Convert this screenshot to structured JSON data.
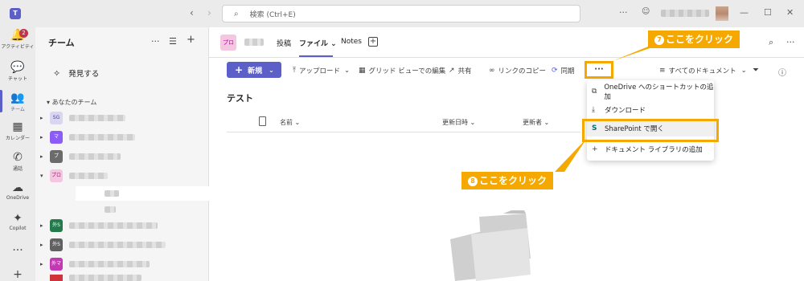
{
  "titlebar": {
    "search_placeholder": "検索 (Ctrl+E)",
    "back": "‹",
    "forward": "›",
    "more": "···",
    "minimize": "—",
    "maximize": "☐",
    "close": "✕"
  },
  "rail": {
    "items": [
      {
        "label": "アクティビティ",
        "icon": "bell-icon",
        "glyph": "🔔",
        "badge": "2"
      },
      {
        "label": "チャット",
        "icon": "chat-icon",
        "glyph": "💬"
      },
      {
        "label": "チーム",
        "icon": "teams-icon",
        "glyph": "👥"
      },
      {
        "label": "カレンダー",
        "icon": "calendar-icon",
        "glyph": "▦"
      },
      {
        "label": "通話",
        "icon": "phone-icon",
        "glyph": "✆"
      },
      {
        "label": "OneDrive",
        "icon": "cloud-icon",
        "glyph": "☁"
      },
      {
        "label": "Copilot",
        "icon": "copilot-icon",
        "glyph": "✦"
      }
    ],
    "more": "···",
    "apps": "+"
  },
  "panel": {
    "title": "チーム",
    "discover": "発見する",
    "section": "あなたのチーム",
    "teams": [
      {
        "abbr": "SG",
        "color": "#d9d6f2",
        "text_color": "#444791"
      },
      {
        "abbr": "マ",
        "color": "#8b5cf6",
        "text_color": "#ffffff"
      },
      {
        "abbr": "プ",
        "color": "#6b6b6b",
        "text_color": "#ffffff"
      },
      {
        "abbr": "プロ",
        "color": "#f5c6e0",
        "text_color": "#b4009e"
      },
      {
        "abbr": "外S",
        "color": "#237b4b",
        "text_color": "#ffffff"
      },
      {
        "abbr": "外S",
        "color": "#616161",
        "text_color": "#ffffff"
      },
      {
        "abbr": "外マ",
        "color": "#c239b3",
        "text_color": "#ffffff"
      }
    ]
  },
  "header": {
    "channel_abbr": "プロ",
    "tabs": [
      "投稿",
      "ファイル",
      "Notes"
    ],
    "active_tab_chevron": "⌄"
  },
  "toolbar": {
    "new_label": "新規",
    "upload": "アップロード",
    "grid_edit": "グリッド ビューでの編集",
    "share": "共有",
    "copy_link": "リンクのコピー",
    "sync": "同期",
    "more": "···",
    "view": "すべてのドキュメント"
  },
  "files": {
    "folder_title": "テスト",
    "col_name": "名前",
    "col_modified": "更新日時",
    "col_modified_by": "更新者"
  },
  "menu": {
    "items": [
      {
        "label": "OneDrive へのショートカットの追加",
        "icon": "shortcut-icon",
        "glyph": "⧉"
      },
      {
        "label": "ダウンロード",
        "icon": "download-icon",
        "glyph": "⤓"
      },
      {
        "label": "SharePoint で開く",
        "icon": "sharepoint-icon",
        "glyph": "S"
      },
      {
        "label": "ドキュメント ライブラリの追加",
        "icon": "plus-icon",
        "glyph": "+"
      }
    ]
  },
  "callouts": {
    "step7_num": "7",
    "step7_text": "ここをクリック",
    "step8_num": "8",
    "step8_text": "ここをクリック"
  },
  "colors": {
    "accent": "#5b5fc7",
    "highlight": "#f5a800"
  }
}
